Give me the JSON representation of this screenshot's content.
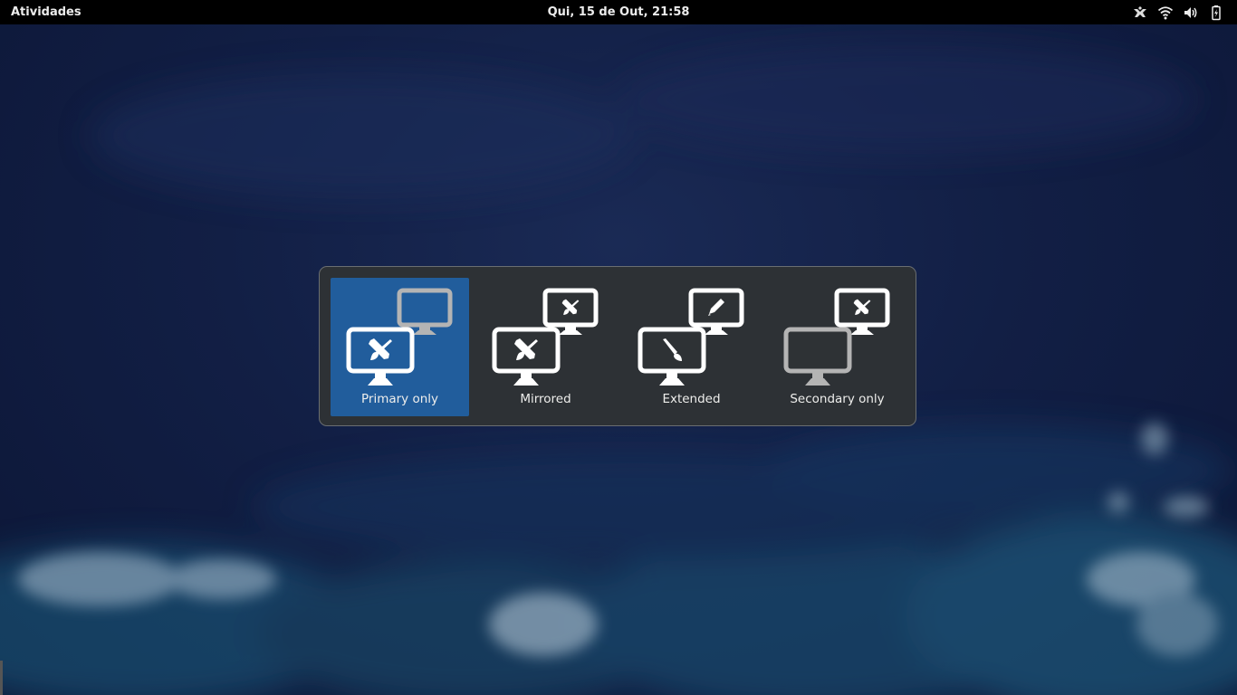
{
  "topbar": {
    "activities": "Atividades",
    "clock": "Qui, 15 de Out, 21:58",
    "tray_icons": [
      "accessibility-icon",
      "wifi-icon",
      "volume-icon",
      "battery-icon"
    ]
  },
  "switcher": {
    "options": [
      {
        "label": "Primary only",
        "selected": true
      },
      {
        "label": "Mirrored",
        "selected": false
      },
      {
        "label": "Extended",
        "selected": false
      },
      {
        "label": "Secondary only",
        "selected": false
      }
    ]
  },
  "colors": {
    "topbar": "#000000",
    "switcher_bg": "#2e3235",
    "selected": "#215d9c",
    "monitor_active": "#ffffff",
    "monitor_inactive": "#b4b4b4"
  }
}
